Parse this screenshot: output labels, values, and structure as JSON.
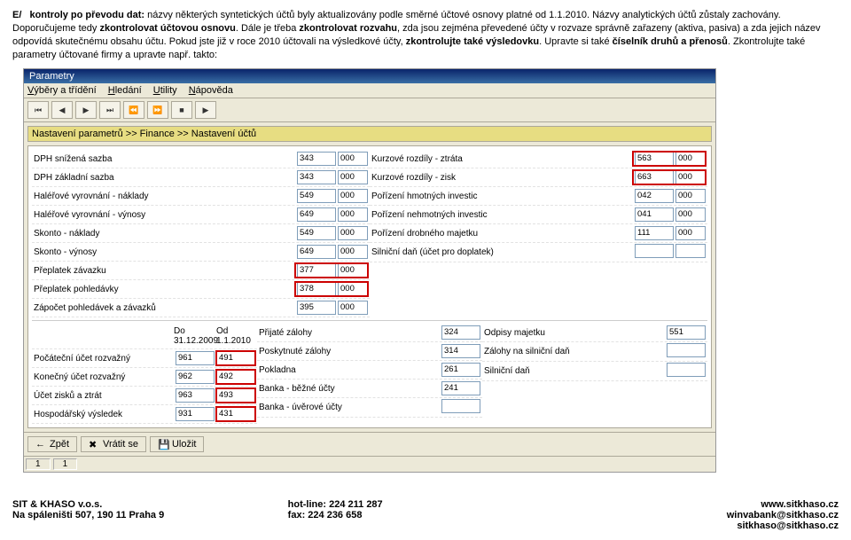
{
  "intro": {
    "lead": "E/",
    "p1a": "kontroly po převodu dat:",
    "p1b": " názvy některých syntetických účtů byly aktualizovány podle směrné účtové osnovy platné od 1.1.2010. Názvy analytických účtů zůstaly zachovány. Doporučujeme tedy ",
    "p1c": "zkontrolovat účtovou osnovu",
    "p1d": ". Dále je třeba ",
    "p1e": "zkontrolovat rozvahu",
    "p1f": ", zda jsou zejména převedené účty v rozvaze správně zařazeny (aktiva, pasiva) a zda jejich název odpovídá skutečnému obsahu účtu. Pokud jste již v roce 2010 účtovali na výsledkové účty, ",
    "p1g": "zkontrolujte také výsledovku",
    "p1h": ". Upravte si také ",
    "p1i": "číselník druhů a přenosů",
    "p1j": ". Zkontrolujte také parametry účtované firmy a upravte např. takto:"
  },
  "app": {
    "title": "Parametry",
    "menu": [
      "Výběry a třídění",
      "Hledání",
      "Utility",
      "Nápověda"
    ],
    "crumb": "Nastavení parametrů >> Finance >> Nastavení účtů",
    "left": [
      {
        "label": "DPH snížená sazba",
        "a": "343",
        "b": "000",
        "hl": false
      },
      {
        "label": "DPH základní sazba",
        "a": "343",
        "b": "000",
        "hl": false
      },
      {
        "label": "Haléřové vyrovnání - náklady",
        "a": "549",
        "b": "000",
        "hl": false
      },
      {
        "label": "Haléřové vyrovnání - výnosy",
        "a": "649",
        "b": "000",
        "hl": false
      },
      {
        "label": "Skonto - náklady",
        "a": "549",
        "b": "000",
        "hl": false
      },
      {
        "label": "Skonto - výnosy",
        "a": "649",
        "b": "000",
        "hl": false
      },
      {
        "label": "Přeplatek závazku",
        "a": "377",
        "b": "000",
        "hl": true
      },
      {
        "label": "Přeplatek pohledávky",
        "a": "378",
        "b": "000",
        "hl": true
      },
      {
        "label": "Zápočet pohledávek a závazků",
        "a": "395",
        "b": "000",
        "hl": false
      }
    ],
    "right": [
      {
        "label": "Kurzové rozdíly - ztráta",
        "a": "563",
        "b": "000",
        "hl": true
      },
      {
        "label": "Kurzové rozdíly - zisk",
        "a": "663",
        "b": "000",
        "hl": true
      },
      {
        "label": "Pořízení hmotných investic",
        "a": "042",
        "b": "000",
        "hl": false
      },
      {
        "label": "Pořízení nehmotných investic",
        "a": "041",
        "b": "000",
        "hl": false
      },
      {
        "label": "Pořízení drobného majetku",
        "a": "111",
        "b": "000",
        "hl": false
      },
      {
        "label": "Silniční daň (účet pro doplatek)",
        "a": "",
        "b": "",
        "hl": false
      }
    ],
    "hdr_old": "Do 31.12.2009",
    "hdr_new": "Od 1.1.2010",
    "bottom_left": [
      {
        "label": "Počáteční účet rozvažný",
        "a": "961",
        "b": "491",
        "hl": true
      },
      {
        "label": "Konečný účet rozvažný",
        "a": "962",
        "b": "492",
        "hl": true
      },
      {
        "label": "Účet zisků a ztrát",
        "a": "963",
        "b": "493",
        "hl": true
      },
      {
        "label": "Hospodářský výsledek",
        "a": "931",
        "b": "431",
        "hl": true
      }
    ],
    "bottom_mid": [
      {
        "label": "Přijaté zálohy",
        "a": "324"
      },
      {
        "label": "Poskytnuté zálohy",
        "a": "314"
      },
      {
        "label": "Pokladna",
        "a": "261"
      },
      {
        "label": "Banka - běžné účty",
        "a": "241"
      },
      {
        "label": "Banka - úvěrové účty",
        "a": ""
      }
    ],
    "bottom_right": [
      {
        "label": "Odpisy majetku",
        "a": "551"
      },
      {
        "label": "Zálohy na silniční daň",
        "a": ""
      },
      {
        "label": "Silniční daň",
        "a": ""
      }
    ],
    "buttons": {
      "back": "Zpět",
      "exit": "Vrátit se",
      "save": "Uložit"
    },
    "status": [
      "1",
      "1"
    ]
  },
  "footer": {
    "l1": "SIT & KHASO v.o.s.",
    "l2": "Na spáleništi 507, 190 11 Praha 9",
    "m1": "hot-line: 224 211 287",
    "m2": "fax:        224 236 658",
    "r1": "www.sitkhaso.cz",
    "r2": "winvabank@sitkhaso.cz",
    "r3": "sitkhaso@sitkhaso.cz"
  }
}
